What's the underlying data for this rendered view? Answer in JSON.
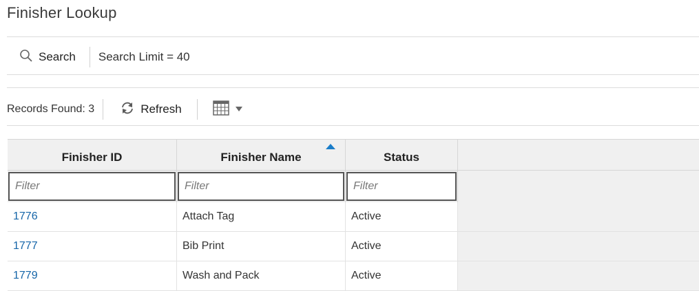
{
  "page": {
    "title": "Finisher Lookup"
  },
  "search_bar": {
    "search_label": "Search",
    "search_limit": "Search Limit = 40"
  },
  "results_toolbar": {
    "records_found": "Records Found: 3",
    "refresh_label": "Refresh",
    "view_icon": "table-grid-icon",
    "dropdown_icon": "caret-down-icon"
  },
  "table": {
    "columns": [
      {
        "label": "Finisher ID"
      },
      {
        "label": "Finisher Name",
        "sorted": "ascending"
      },
      {
        "label": "Status"
      }
    ],
    "filter_placeholder": "Filter",
    "rows": [
      {
        "id": "1776",
        "name": "Attach Tag",
        "status": "Active"
      },
      {
        "id": "1777",
        "name": "Bib Print",
        "status": "Active"
      },
      {
        "id": "1779",
        "name": "Wash and Pack",
        "status": "Active"
      }
    ]
  },
  "colors": {
    "link": "#1565a8",
    "sort_indicator": "#1a7dc9",
    "header_bg": "#f0f0f0"
  }
}
